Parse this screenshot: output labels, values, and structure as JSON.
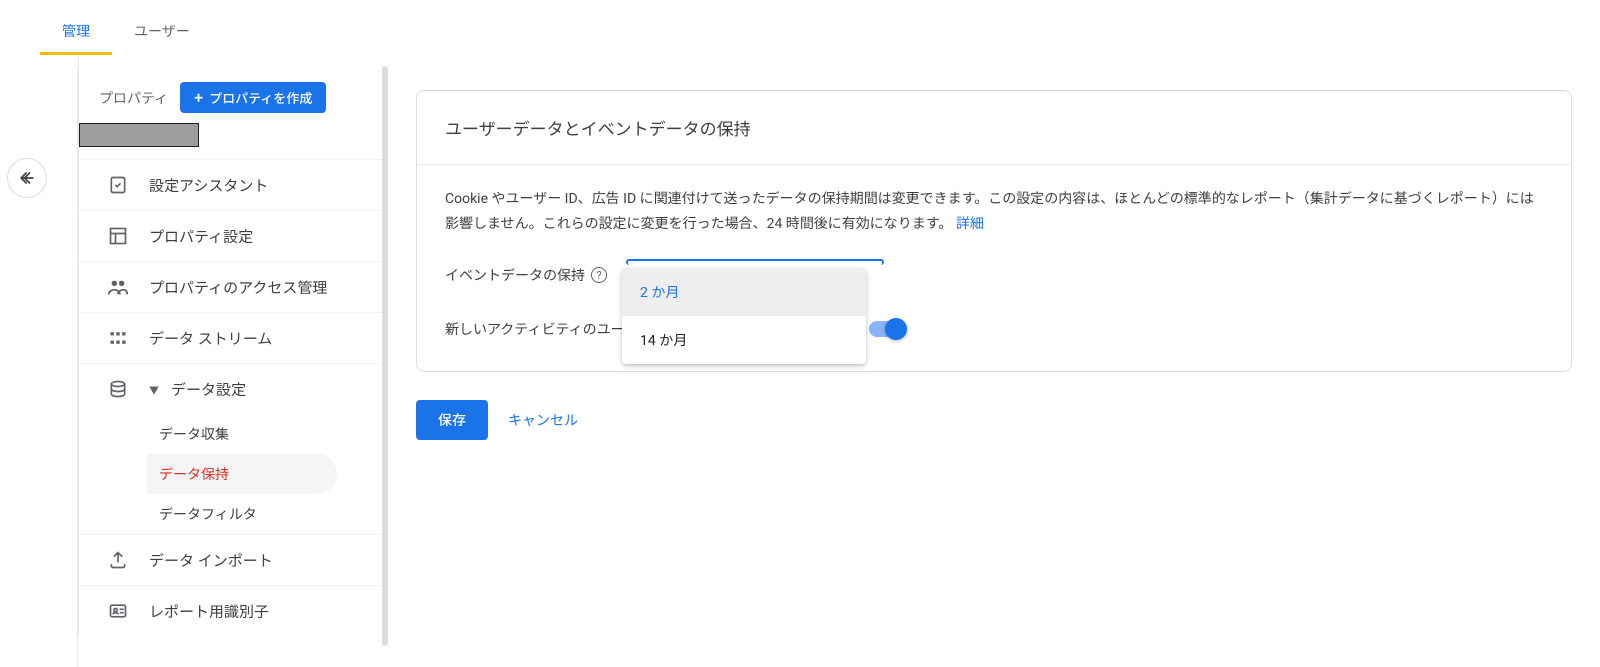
{
  "tabs": {
    "admin": "管理",
    "user": "ユーザー"
  },
  "sidebar": {
    "property_label": "プロパティ",
    "create_property": "プロパティを作成",
    "items": {
      "setup_assistant": "設定アシスタント",
      "property_settings": "プロパティ設定",
      "access_management": "プロパティのアクセス管理",
      "data_streams": "データ ストリーム",
      "data_settings": "データ設定",
      "data_import": "データ インポート",
      "report_identifiers": "レポート用識別子"
    },
    "sub_items": {
      "data_collection": "データ収集",
      "data_retention": "データ保持",
      "data_filter": "データフィルタ"
    }
  },
  "card": {
    "title": "ユーザーデータとイベントデータの保持",
    "description": "Cookie やユーザー ID、広告 ID に関連付けて送ったデータの保持期間は変更できます。この設定の内容は、ほとんどの標準的なレポート（集計データに基づくレポート）には影響しません。これらの設定に変更を行った場合、24 時間後に有効になります。",
    "details_link": "詳細",
    "event_retention_label": "イベントデータの保持",
    "reset_user_label": "新しいアクティビティのユー"
  },
  "dropdown": {
    "option_2m": "2 か月",
    "option_14m": "14 か月"
  },
  "actions": {
    "save": "保存",
    "cancel": "キャンセル"
  }
}
